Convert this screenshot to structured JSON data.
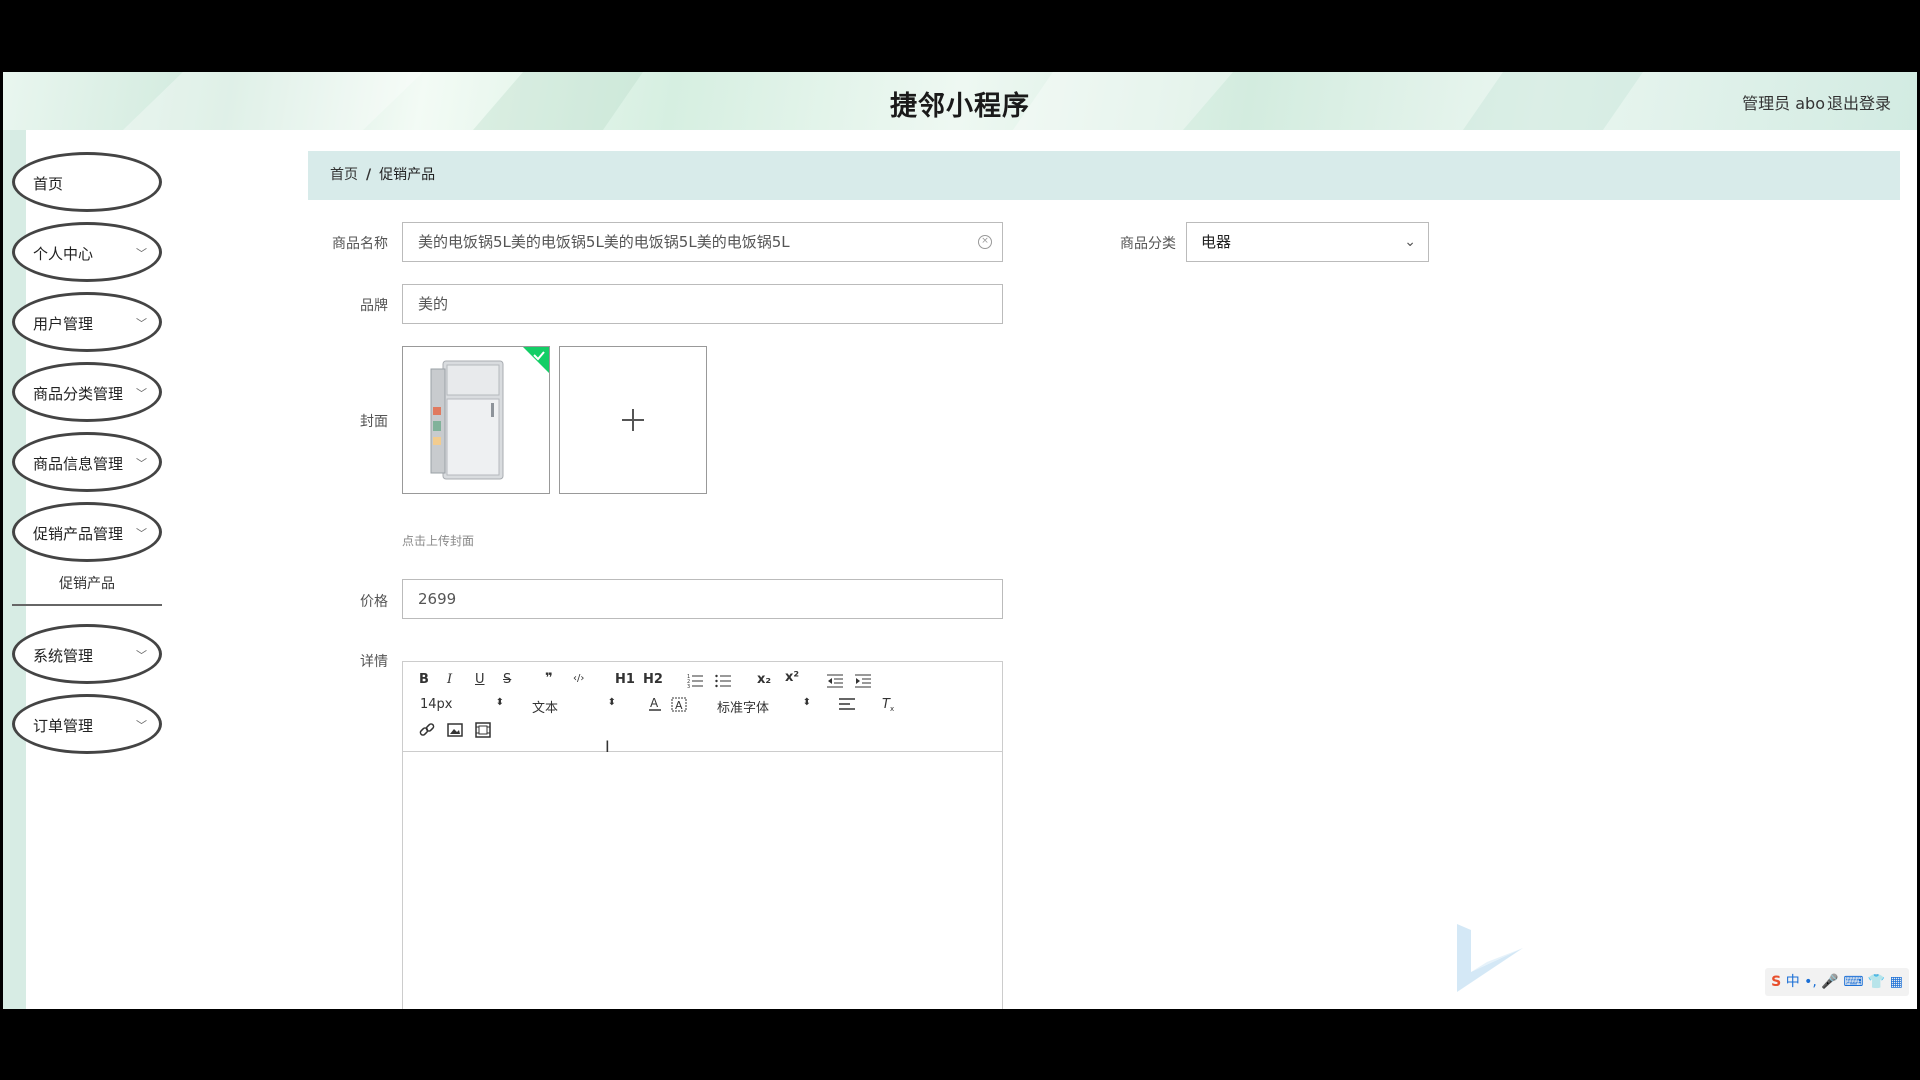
{
  "header": {
    "title": "捷邻小程序",
    "user": "管理员 abo",
    "logout": "退出登录"
  },
  "sidebar": {
    "items": [
      {
        "label": "首页",
        "has_arrow": false
      },
      {
        "label": "个人中心",
        "has_arrow": true
      },
      {
        "label": "用户管理",
        "has_arrow": true
      },
      {
        "label": "商品分类管理",
        "has_arrow": true
      },
      {
        "label": "商品信息管理",
        "has_arrow": true
      },
      {
        "label": "促销产品管理",
        "has_arrow": true
      },
      {
        "label": "系统管理",
        "has_arrow": true
      },
      {
        "label": "订单管理",
        "has_arrow": true
      }
    ],
    "sub_item": "促销产品"
  },
  "breadcrumb": {
    "home": "首页",
    "separator": "/",
    "current": "促销产品"
  },
  "form": {
    "name_label": "商品名称",
    "name_value": "美的电饭锅5L美的电饭锅5L美的电饭锅5L美的电饭锅5L",
    "category_label": "商品分类",
    "category_value": "电器",
    "brand_label": "品牌",
    "brand_value": "美的",
    "cover_label": "封面",
    "upload_tip": "点击上传封面",
    "price_label": "价格",
    "price_value": "2699",
    "detail_label": "详情"
  },
  "editor": {
    "toolbar_row1": [
      "B",
      "I",
      "U",
      "S",
      "❞",
      "‹/›",
      "H1",
      "H2",
      "ordered-list",
      "bullet-list",
      "x₂",
      "x²",
      "outdent",
      "indent"
    ],
    "font_size": "14px",
    "header_select": "文本",
    "font_family": "标准字体",
    "content": ""
  },
  "ime": {
    "mode": "中"
  },
  "colors": {
    "header_bg": "#d6efe1",
    "breadcrumb_bg": "#d8ebea",
    "sidebar_border": "#444444",
    "success_badge": "#13ce66"
  },
  "icons": [
    "clear-icon",
    "chevron-down-icon",
    "plus-icon",
    "check-icon",
    "fridge-image"
  ]
}
